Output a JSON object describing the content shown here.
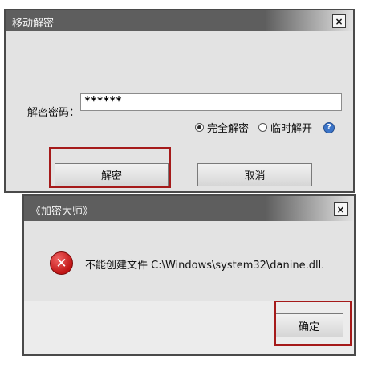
{
  "decrypt_dialog": {
    "title": "移动解密",
    "close_glyph": "×",
    "password_label": "解密密码：",
    "password_value": "******",
    "radio_full_label": "完全解密",
    "radio_temp_label": "临时解开",
    "selected_mode": "完全解密",
    "help_glyph": "?",
    "decrypt_button": "解密",
    "cancel_button": "取消"
  },
  "error_dialog": {
    "title": "《加密大师》",
    "close_glyph": "×",
    "message": "不能创建文件 C:\\Windows\\system32\\danine.dll.",
    "error_glyph": "✕",
    "ok_button": "确定"
  },
  "colors": {
    "highlight": "#a51a1a",
    "titlebar": "#5e5e5e",
    "dialog_bg": "#e3e3e3"
  }
}
